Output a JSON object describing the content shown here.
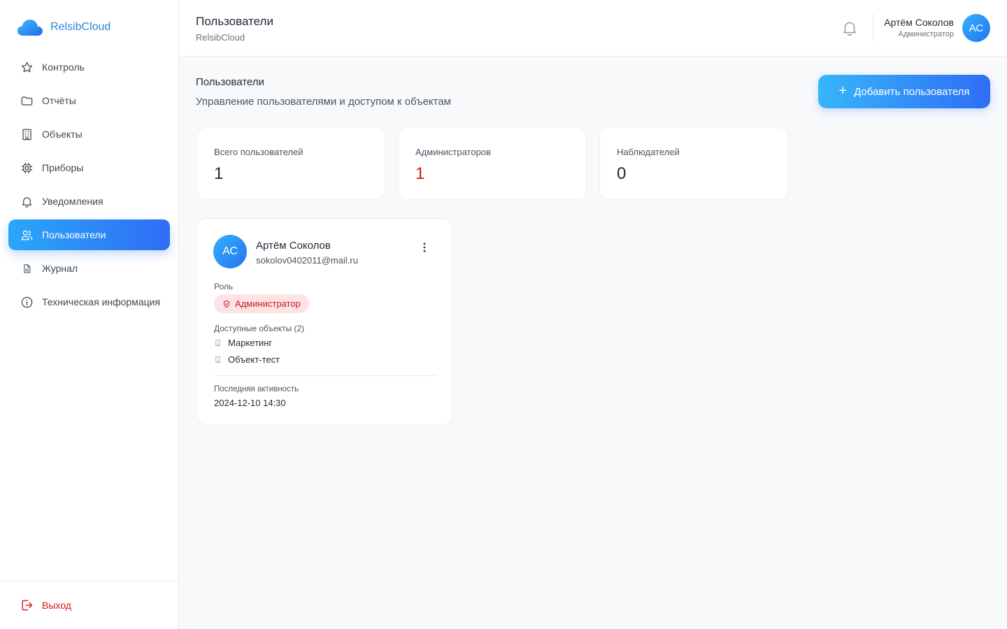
{
  "brand": {
    "name": "RelsibCloud"
  },
  "sidebar": {
    "items": [
      {
        "label": "Контроль",
        "icon": "star-icon"
      },
      {
        "label": "Отчёты",
        "icon": "folder-icon"
      },
      {
        "label": "Объекты",
        "icon": "building-icon"
      },
      {
        "label": "Приборы",
        "icon": "chip-icon"
      },
      {
        "label": "Уведомления",
        "icon": "bell-icon"
      },
      {
        "label": "Пользователи",
        "icon": "users-icon",
        "active": true
      },
      {
        "label": "Журнал",
        "icon": "document-icon"
      },
      {
        "label": "Техническая информация",
        "icon": "info-icon"
      }
    ],
    "logout_label": "Выход"
  },
  "header": {
    "title": "Пользователи",
    "subtitle": "RelsibCloud",
    "user_name": "Артём Соколов",
    "user_role": "Администратор",
    "avatar_initials": "АС"
  },
  "main": {
    "title": "Пользователи",
    "description": "Управление пользователями и доступом к объектам",
    "add_button_label": "Добавить пользователя"
  },
  "stats": [
    {
      "label": "Всего пользователей",
      "value": "1"
    },
    {
      "label": "Администраторов",
      "value": "1"
    },
    {
      "label": "Наблюдателей",
      "value": "0"
    }
  ],
  "user_card": {
    "initials": "АС",
    "name": "Артём Соколов",
    "email": "sokolov0402011@mail.ru",
    "role_label": "Роль",
    "role": "Администратор",
    "objects_label": "Доступные объекты (2)",
    "objects": [
      "Маркетинг",
      "Объект-тест"
    ],
    "last_activity_label": "Последняя активность",
    "last_activity": "2024-12-10 14:30"
  },
  "colors": {
    "accent_start": "#2aa7f8",
    "accent_end": "#2f6df5",
    "danger": "#d11a1a",
    "badge_bg": "#fde3e3"
  }
}
